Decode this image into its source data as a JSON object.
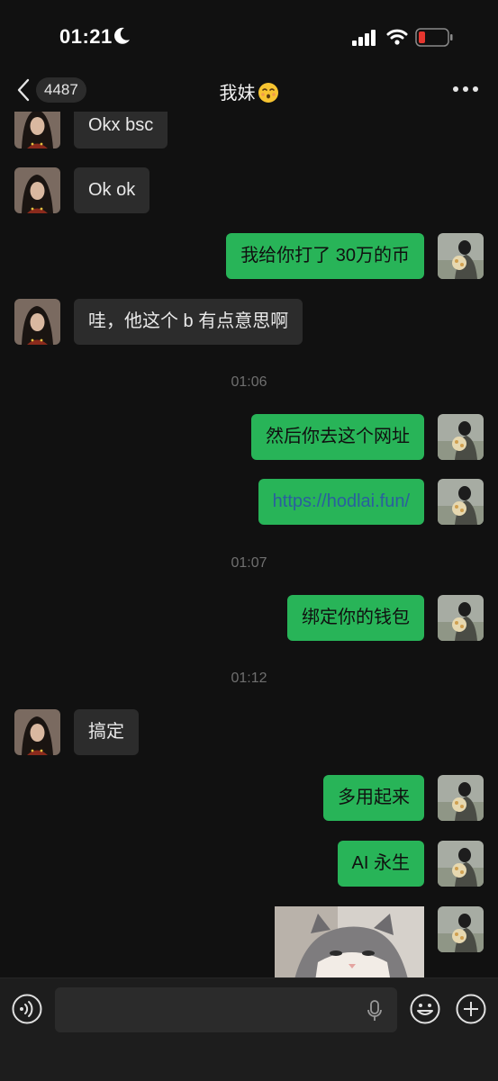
{
  "status_bar": {
    "time": "01:21",
    "icons": [
      "moon-icon",
      "signal-icon",
      "wifi-icon",
      "battery-low-icon"
    ],
    "battery_color": "#e5362f"
  },
  "nav": {
    "back_icon": "chevron-left-icon",
    "unread_count": "4487",
    "title": "我妹",
    "title_emoji": "kissing-face-emoji",
    "more_icon": "ellipsis-icon"
  },
  "colors": {
    "outgoing_bubble": "#28b458",
    "incoming_bubble": "#2c2c2c",
    "background": "#111111",
    "link": "#2a5f9e"
  },
  "messages": [
    {
      "side": "in",
      "text": "Okx bsc"
    },
    {
      "side": "in",
      "text": "Ok ok"
    },
    {
      "side": "out",
      "text": "我给你打了 30万的币"
    },
    {
      "side": "in",
      "text": "哇，他这个 b 有点意思啊"
    },
    {
      "type": "time",
      "text": "01:06"
    },
    {
      "side": "out",
      "text": "然后你去这个网址"
    },
    {
      "side": "out",
      "text": "https://hodlai.fun/",
      "is_link": true
    },
    {
      "type": "time",
      "text": "01:07"
    },
    {
      "side": "out",
      "text": "绑定你的钱包"
    },
    {
      "type": "time",
      "text": "01:12"
    },
    {
      "side": "in",
      "text": "搞定"
    },
    {
      "side": "out",
      "text": "多用起来"
    },
    {
      "side": "out",
      "text": "AI 永生"
    },
    {
      "side": "out",
      "type": "image",
      "content": "cat-photo"
    }
  ],
  "input_bar": {
    "icons": [
      "voice-icon",
      "microphone-icon",
      "emoji-icon",
      "plus-icon"
    ]
  }
}
